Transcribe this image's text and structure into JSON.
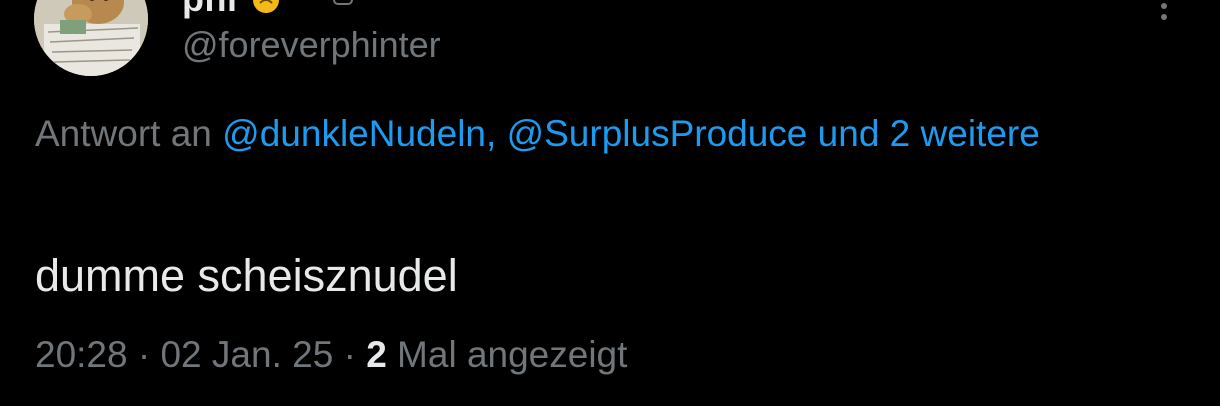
{
  "author": {
    "display_name": "phi",
    "handle": "@foreverphinter"
  },
  "icons": {
    "avatar": "avatar-photo",
    "name_emoji": "emoji-icon",
    "verified": "verified-icon",
    "more": "more-vertical-icon"
  },
  "reply": {
    "prefix": "Antwort an",
    "mention_1": "@dunkleNudeln,",
    "mention_2": "@SurplusProduce",
    "and_more": "und 2 weitere"
  },
  "tweet": {
    "text": "dumme scheisznudel"
  },
  "meta": {
    "time": "20:28",
    "separator_1": "·",
    "date": "02 Jan. 25",
    "separator_2": "·",
    "views_count": "2",
    "views_label": "Mal angezeigt"
  },
  "colors": {
    "background": "#000000",
    "primary_text": "#e7e9ea",
    "secondary_text": "#71767b",
    "link": "#1d9bf0"
  }
}
